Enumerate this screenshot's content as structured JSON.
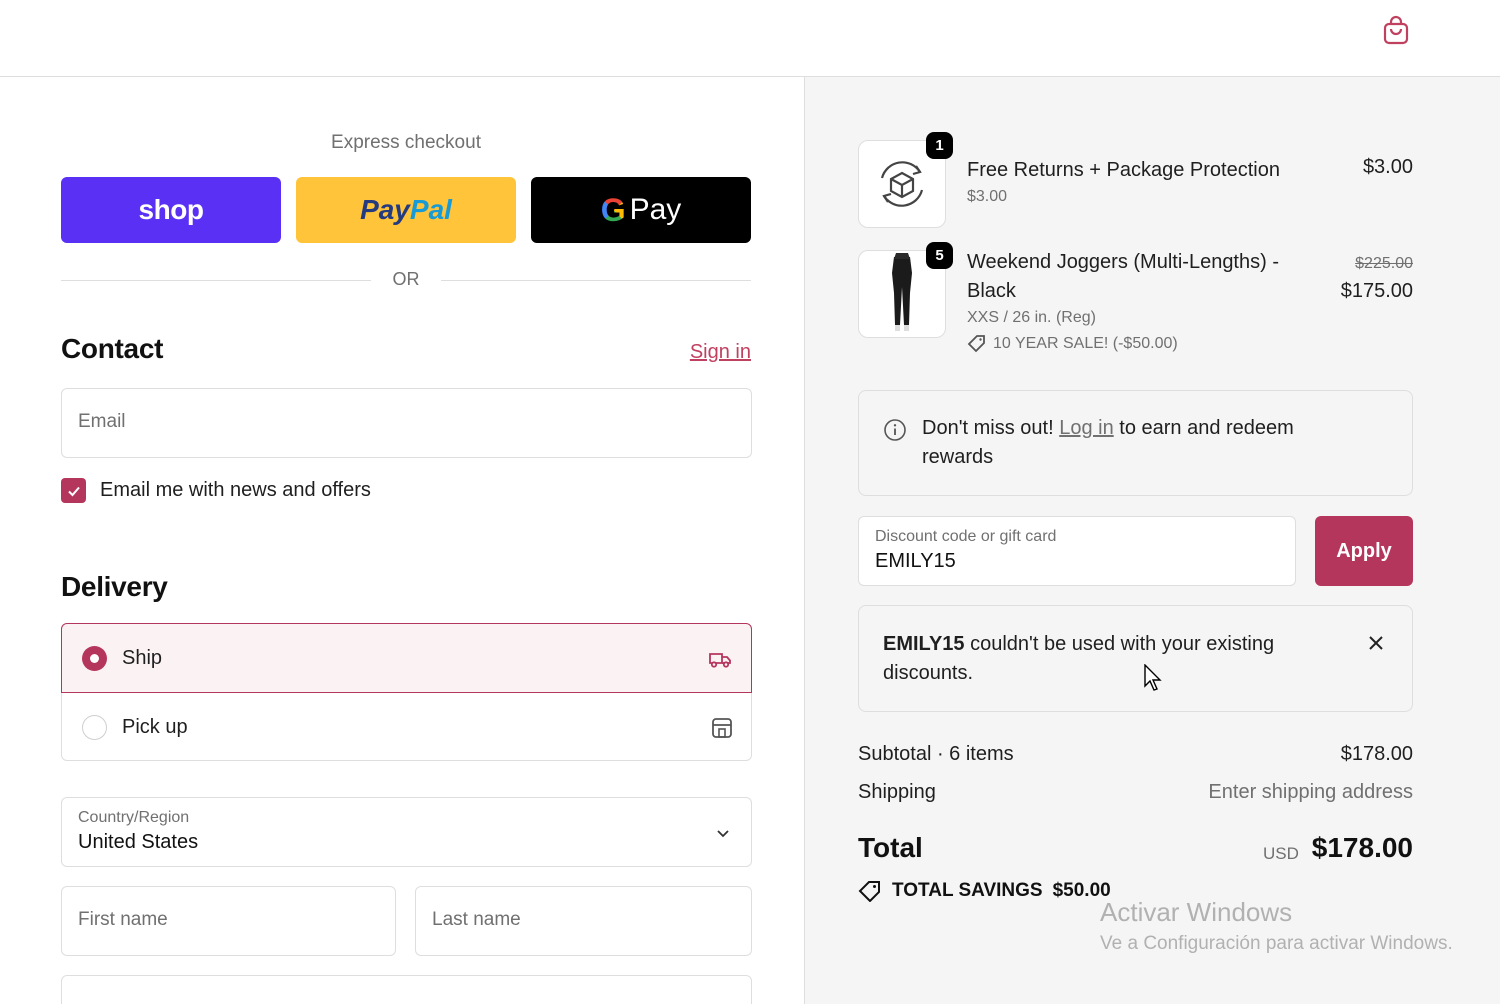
{
  "header": {
    "cart_icon": "shopping-bag-icon",
    "accent": "#c0405f"
  },
  "express": {
    "title": "Express checkout",
    "shop_label": "shop",
    "paypal_part1": "Pay",
    "paypal_part2": "Pal",
    "gpay_g": "G",
    "gpay_label": "Pay",
    "or_label": "OR"
  },
  "contact": {
    "title": "Contact",
    "signin_label": "Sign in",
    "email_placeholder": "Email",
    "newsletter_label": "Email me with news and offers",
    "newsletter_checked": true
  },
  "delivery": {
    "title": "Delivery",
    "options": [
      {
        "label": "Ship",
        "selected": true,
        "icon": "truck-icon"
      },
      {
        "label": "Pick up",
        "selected": false,
        "icon": "store-icon"
      }
    ],
    "country_label": "Country/Region",
    "country_value": "United States",
    "first_name_placeholder": "First name",
    "last_name_placeholder": "Last name"
  },
  "summary": {
    "items": [
      {
        "name": "Free Returns + Package Protection",
        "qty": "1",
        "sub": "$3.00",
        "price": "$3.00",
        "image": "package-protection-icon"
      },
      {
        "name_line1": "Weekend Joggers (Multi-Lengths) -",
        "name_line2": "Black",
        "qty": "5",
        "variant": "XXS / 26 in. (Reg)",
        "discount": "10 YEAR SALE! (-$50.00)",
        "compare_price": "$225.00",
        "price": "$175.00",
        "image": "joggers-photo"
      }
    ],
    "rewards": {
      "prefix": "Don't miss out!",
      "link": "Log in",
      "suffix_line1": "to earn and redeem",
      "suffix_line2": "rewards"
    },
    "discount_label": "Discount code or gift card",
    "discount_value": "EMILY15",
    "apply_label": "Apply",
    "error": {
      "code": "EMILY15",
      "line1": " couldn't be used with your existing",
      "line2": "discounts."
    },
    "subtotal_label": "Subtotal · 6 items",
    "subtotal_value": "$178.00",
    "shipping_label": "Shipping",
    "shipping_value": "Enter shipping address",
    "total_label": "Total",
    "total_currency": "USD",
    "total_value": "$178.00",
    "savings_label": "TOTAL SAVINGS",
    "savings_value": "$50.00"
  },
  "watermark": {
    "line1": "Activar Windows",
    "line2": "Ve a Configuración para activar Windows."
  }
}
